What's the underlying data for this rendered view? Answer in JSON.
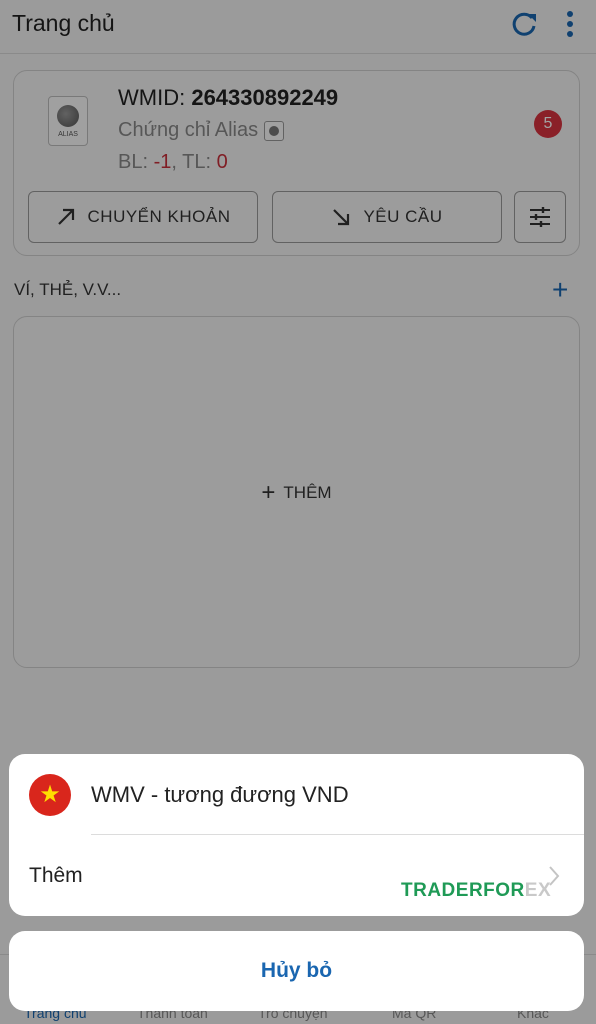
{
  "header": {
    "title": "Trang chủ",
    "refresh_icon": "refresh-icon",
    "menu_icon": "more-vertical-icon"
  },
  "account": {
    "wmid_label": "WMID:",
    "wmid_value": "264330892249",
    "logo_text": "ALIAS",
    "certificate": "Chứng chỉ Alias",
    "bl_label": "BL:",
    "bl_value": "-1",
    "tl_label": "TL:",
    "tl_value": "0",
    "transfer_label": "CHUYỂN KHOẢN",
    "request_label": "YÊU CẦU",
    "filter_badge": "5"
  },
  "wallets": {
    "section_label": "VÍ, THẺ, V.V...",
    "add_label": "THÊM"
  },
  "tabs": [
    "Trang chủ",
    "Thanh toán",
    "Trò chuyện",
    "Mã QR",
    "Khác"
  ],
  "sheet": {
    "option_label": "WMV - tương đương VND",
    "more_label": "Thêm",
    "watermark": {
      "part1": "TRADERFOR",
      "part2": "EX"
    },
    "cancel_label": "Hủy bỏ"
  },
  "colors": {
    "accent": "#1a66b0",
    "badge": "#d8333f",
    "negative": "#c8303b",
    "flag_red": "#d9261c",
    "flag_star": "#ffde00",
    "watermark": "#1f9a56"
  }
}
